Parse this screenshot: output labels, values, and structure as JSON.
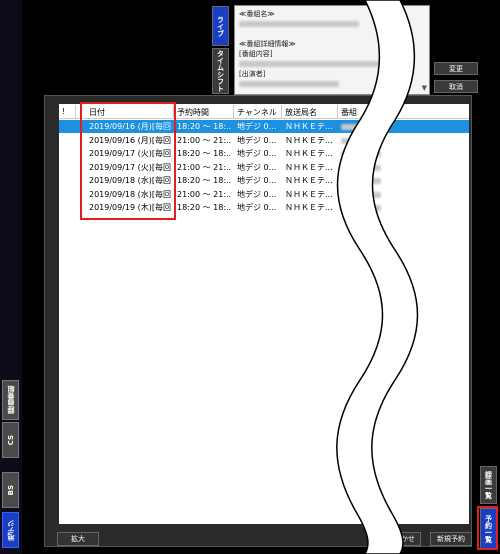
{
  "side_tabs": [
    {
      "label": "録画番組",
      "active": false
    },
    {
      "label": "CS",
      "active": false
    },
    {
      "label": "BS",
      "active": false
    },
    {
      "label": "地デジ",
      "active": true
    }
  ],
  "top_tabs": [
    {
      "label": "ライブ",
      "active": true
    },
    {
      "label": "タイムシフト",
      "active": false
    }
  ],
  "detail": {
    "program_name_label": "≪番組名≫",
    "program_detail_label": "≪番組詳細情報≫",
    "program_content_label": "[番組内容]",
    "cast_label": "[出演者]"
  },
  "detail_buttons": {
    "change": "変更",
    "cancel": "取消"
  },
  "table": {
    "columns": [
      "!",
      "日付",
      "予約時間",
      "チャンネル",
      "放送局名",
      "番組"
    ],
    "rows": [
      {
        "date": "2019/09/16 (月)[毎回]",
        "time": "18:20 ～ 18:...",
        "channel": "地デジ 0...",
        "station": "ＮＨＫＥテ...",
        "selected": true
      },
      {
        "date": "2019/09/16 (月)[毎回]",
        "time": "21:00 ～ 21:...",
        "channel": "地デジ 0...",
        "station": "ＮＨＫＥテ...",
        "selected": false
      },
      {
        "date": "2019/09/17 (火)[毎回]",
        "time": "18:20 ～ 18:...",
        "channel": "地デジ 0...",
        "station": "ＮＨＫＥテ...",
        "selected": false
      },
      {
        "date": "2019/09/17 (火)[毎回]",
        "time": "21:00 ～ 21:...",
        "channel": "地デジ 0...",
        "station": "ＮＨＫＥテ...",
        "selected": false
      },
      {
        "date": "2019/09/18 (水)[毎回]",
        "time": "18:20 ～ 18:...",
        "channel": "地デジ 0...",
        "station": "ＮＨＫＥテ...",
        "selected": false
      },
      {
        "date": "2019/09/18 (水)[毎回]",
        "time": "21:00 ～ 21:...",
        "channel": "地デジ 0...",
        "station": "ＮＨＫＥテ...",
        "selected": false
      },
      {
        "date": "2019/09/19 (木)[毎回]",
        "time": "18:20 ～ 18:...",
        "channel": "地デジ 0...",
        "station": "ＮＨＫＥテ...",
        "selected": false
      }
    ]
  },
  "bottom_buttons": {
    "expand": "拡大",
    "auto": "おまかせ",
    "new_reservation": "新規予約"
  },
  "right_tabs": [
    {
      "label": "録画一覧",
      "active": false
    },
    {
      "label": "予約一覧",
      "active": true
    }
  ],
  "colors": {
    "accent_blue": "#1a3fc4",
    "selection_blue": "#1e90e0",
    "highlight_red": "#e02020"
  }
}
